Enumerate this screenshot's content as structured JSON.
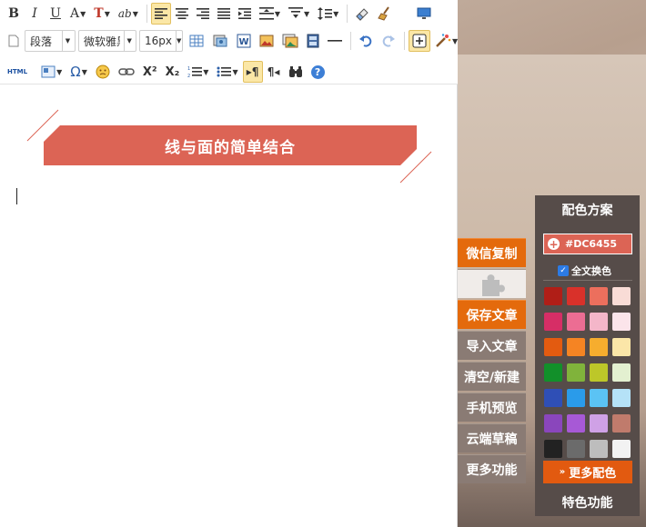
{
  "toolbar": {
    "row1": {
      "bold": "B",
      "italic": "I",
      "underline": "U",
      "font_color": "A",
      "bg_color": "T",
      "format_brush": "ab"
    },
    "row2": {
      "paragraph_select": "段落",
      "font_select": "微软雅黑",
      "size_select": "16px"
    },
    "row3": {
      "html_label": "HTML",
      "omega": "Ω",
      "superscript": "X²",
      "subscript": "X₂",
      "ltr": "▸¶",
      "rtl": "¶◂",
      "help": "?"
    }
  },
  "document": {
    "title": "线与面的简单结合",
    "title_color": "#dc6455"
  },
  "side_actions": [
    {
      "label": "微信复制",
      "style": "orange"
    },
    {
      "label": "",
      "style": "plugin"
    },
    {
      "label": "保存文章",
      "style": "orange"
    },
    {
      "label": "导入文章",
      "style": "gray"
    },
    {
      "label": "清空/新建",
      "style": "gray"
    },
    {
      "label": "手机预览",
      "style": "gray"
    },
    {
      "label": "云端草稿",
      "style": "gray"
    },
    {
      "label": "更多功能",
      "style": "gray"
    }
  ],
  "color_panel": {
    "title": "配色方案",
    "current_color": "#DC6455",
    "apply_all_label": "全文换色",
    "apply_all_checked": true,
    "swatches": [
      "#b01e17",
      "#d9312a",
      "#ec6f5d",
      "#f9dcd6",
      "#d62e66",
      "#ec6d93",
      "#f4b6c9",
      "#fbe4ea",
      "#e35b10",
      "#f58423",
      "#f6ad2e",
      "#fbe6a8",
      "#12902a",
      "#80b33b",
      "#bdc729",
      "#e3f0d0",
      "#2f4fb6",
      "#2a9bea",
      "#5bc3f4",
      "#b5e2f7",
      "#8a46bc",
      "#a759d6",
      "#cfa1e6",
      "#c07b6c",
      "#222222",
      "#6b6b6b",
      "#bdbdbd",
      "#f2f2f2"
    ],
    "more_label": "更多配色",
    "special_label": "特色功能"
  }
}
